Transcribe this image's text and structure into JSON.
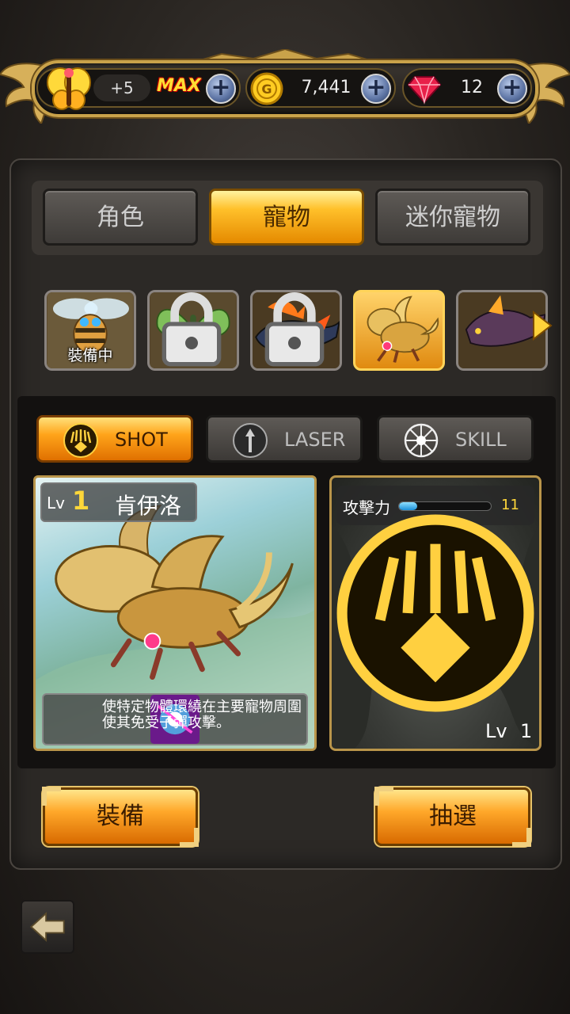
{
  "status_bar": {
    "pet_level": "+5",
    "pet_max_label": "MAX",
    "gold_value": "7,441",
    "gem_value": "12",
    "plus_label": "+"
  },
  "tabs": [
    {
      "label": "角色",
      "active": false
    },
    {
      "label": "寵物",
      "active": true
    },
    {
      "label": "迷你寵物",
      "active": false
    }
  ],
  "pet_carousel": {
    "equipped_label": "裝備中",
    "selected_index": 3
  },
  "attack_modes": [
    {
      "label": "SHOT",
      "active": true
    },
    {
      "label": "LASER",
      "active": false
    },
    {
      "label": "SKILL",
      "active": false
    }
  ],
  "pet_detail": {
    "lv_prefix": "Lv",
    "level": "1",
    "name": "肯伊洛",
    "description": "使特定物體環繞在主要寵物周圍使其免受子彈攻擊。"
  },
  "preview": {
    "power_label": "攻擊力",
    "power_value": "11",
    "power_fraction": 0.2,
    "lv_prefix": "Lv",
    "level": "1"
  },
  "actions": {
    "equip_label": "裝備",
    "draw_label": "抽選"
  },
  "colors": {
    "accent_gold": "#ffa41a",
    "frame_gold": "#c9a24a"
  }
}
